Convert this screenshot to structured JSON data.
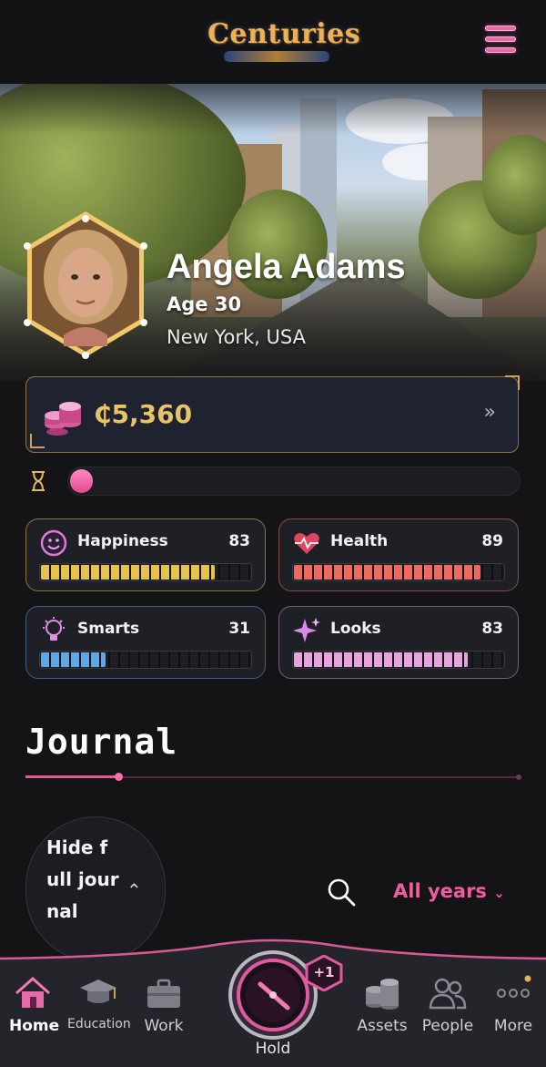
{
  "app": {
    "logo_text": "Centuries"
  },
  "header": {
    "menu_icon": "hamburger-menu-icon"
  },
  "character": {
    "name": "Angela Adams",
    "age": "Age 30",
    "location": "New York, USA"
  },
  "money": {
    "amount": "₵5,360",
    "icon": "coin-stack-icon",
    "arrow": "»"
  },
  "life_progress": {
    "fraction": 0.05,
    "icon": "hourglass-icon"
  },
  "stats": [
    {
      "label": "Happiness",
      "value": "83",
      "level": 0.83,
      "color": "#e6c34a",
      "border": "#8b7838",
      "icon": "smiley-icon"
    },
    {
      "label": "Health",
      "value": "89",
      "level": 0.89,
      "color": "#ee6a5e",
      "border": "#8a4a4a",
      "icon": "heart-pulse-icon"
    },
    {
      "label": "Smarts",
      "value": "31",
      "level": 0.31,
      "color": "#5fa8e6",
      "border": "#3e5f86",
      "icon": "lightbulb-icon"
    },
    {
      "label": "Looks",
      "value": "83",
      "level": 0.83,
      "color": "#e7a3dc",
      "border": "#7a5a84",
      "icon": "sparkles-icon"
    }
  ],
  "journal": {
    "title": "Journal",
    "hide_button": "Hide full journal",
    "year_filter": "All years"
  },
  "nav": {
    "home": "Home",
    "education": "Education",
    "work": "Work",
    "hold": "Hold",
    "hold_badge": "+1",
    "assets": "Assets",
    "people": "People",
    "more": "More"
  }
}
